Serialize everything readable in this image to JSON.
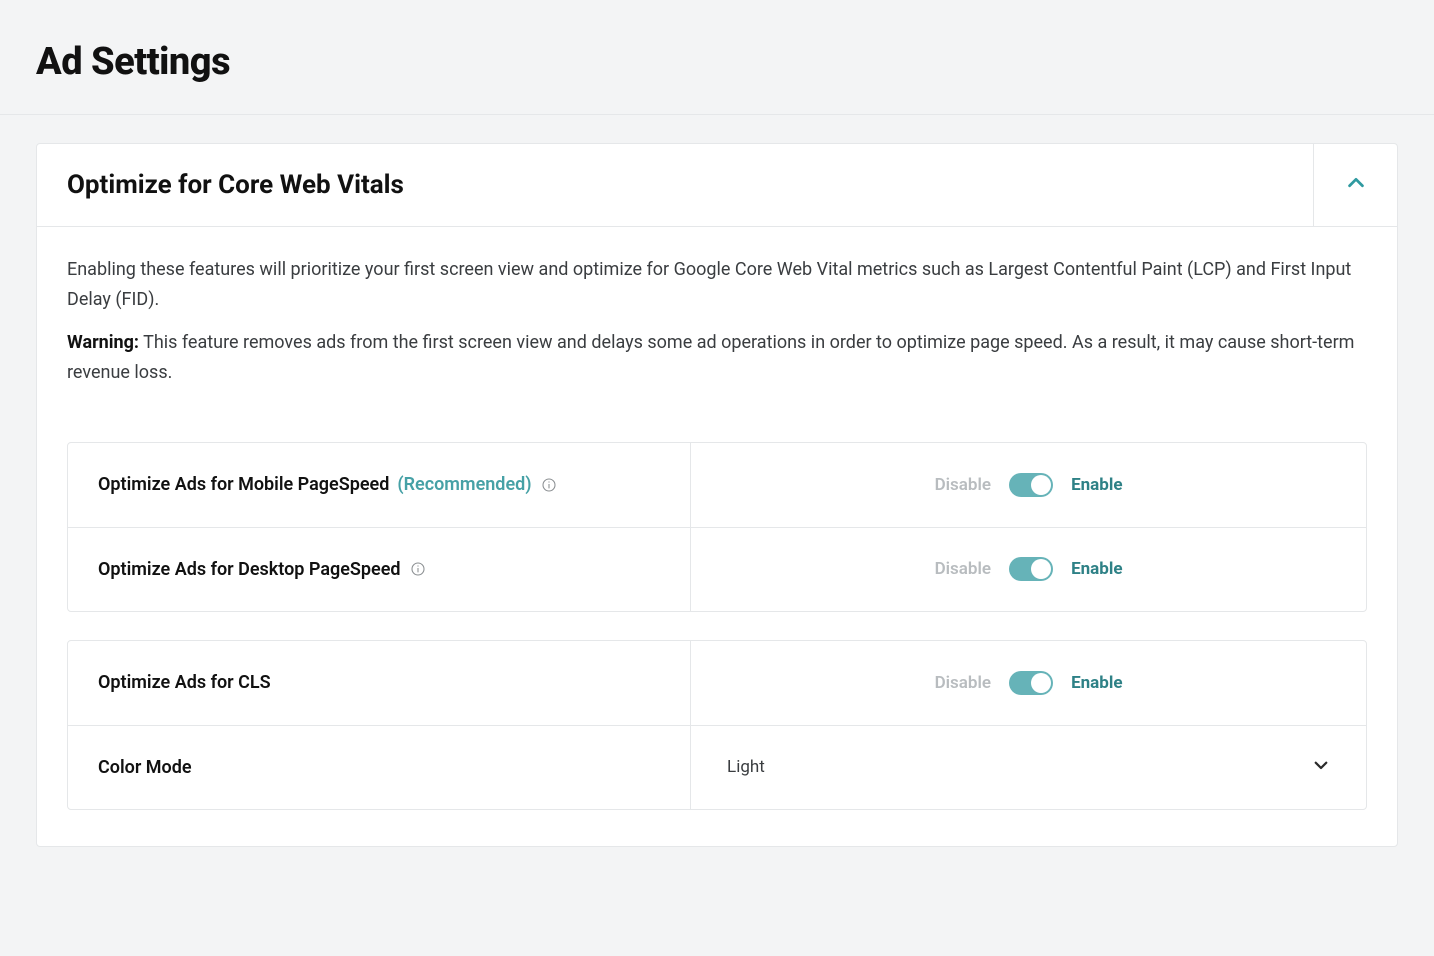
{
  "page": {
    "title": "Ad Settings"
  },
  "panel": {
    "title": "Optimize for Core Web Vitals",
    "description": "Enabling these features will prioritize your first screen view and optimize for Google Core Web Vital metrics such as Largest Contentful Paint (LCP) and First Input Delay (FID).",
    "warning_label": "Warning:",
    "warning_text": " This feature removes ads from the first screen view and delays some ad operations in order to optimize page speed. As a result, it may cause short-term revenue loss."
  },
  "labels": {
    "disable": "Disable",
    "enable": "Enable",
    "recommended": "(Recommended)"
  },
  "settings": {
    "mobile_pagespeed": {
      "label": "Optimize Ads for Mobile PageSpeed ",
      "recommended": true,
      "enabled": true
    },
    "desktop_pagespeed": {
      "label": "Optimize Ads for Desktop PageSpeed",
      "recommended": false,
      "enabled": true
    },
    "cls": {
      "label": "Optimize Ads for CLS",
      "enabled": true
    },
    "color_mode": {
      "label": "Color Mode",
      "value": "Light"
    }
  }
}
